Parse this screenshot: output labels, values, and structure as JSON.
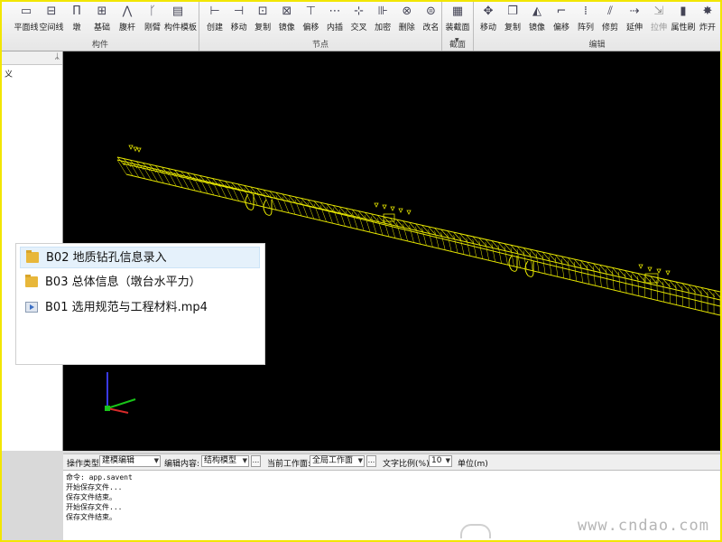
{
  "ribbon": {
    "left_labels": [
      "平面线",
      "空间线",
      "墩",
      "基础",
      "腹杆",
      "刚臂",
      "构件模板"
    ],
    "groups": [
      {
        "label": "构件",
        "tools": [
          {
            "label": "平面线",
            "icon": "plane-line-icon"
          },
          {
            "label": "空间线",
            "icon": "space-line-icon"
          },
          {
            "label": "墩",
            "icon": "pier-icon"
          },
          {
            "label": "基础",
            "icon": "foundation-icon"
          },
          {
            "label": "腹杆",
            "icon": "web-member-icon"
          },
          {
            "label": "刚臂",
            "icon": "rigid-arm-icon"
          },
          {
            "label": "构件模板",
            "icon": "member-template-icon"
          }
        ]
      },
      {
        "label": "节点",
        "tools": [
          {
            "label": "创建",
            "icon": "create-node-icon"
          },
          {
            "label": "移动",
            "icon": "move-node-icon"
          },
          {
            "label": "复制",
            "icon": "copy-node-icon"
          },
          {
            "label": "镜像",
            "icon": "mirror-node-icon"
          },
          {
            "label": "偏移",
            "icon": "offset-node-icon"
          },
          {
            "label": "内插",
            "icon": "interpolate-icon"
          },
          {
            "label": "交叉",
            "icon": "intersect-icon"
          },
          {
            "label": "加密",
            "icon": "densify-icon"
          },
          {
            "label": "删除",
            "icon": "delete-node-icon"
          },
          {
            "label": "改名",
            "icon": "rename-node-icon"
          }
        ]
      },
      {
        "label": "截面",
        "tools": [
          {
            "label": "装截面",
            "icon": "section-icon"
          }
        ]
      },
      {
        "label": "编辑",
        "tools": [
          {
            "label": "移动",
            "icon": "move-icon"
          },
          {
            "label": "复制",
            "icon": "copy-icon"
          },
          {
            "label": "镜像",
            "icon": "mirror-icon"
          },
          {
            "label": "偏移",
            "icon": "offset-icon"
          },
          {
            "label": "阵列",
            "icon": "array-icon"
          },
          {
            "label": "修剪",
            "icon": "trim-icon"
          },
          {
            "label": "延伸",
            "icon": "extend-icon"
          },
          {
            "label": "拉伸",
            "icon": "stretch-icon"
          },
          {
            "label": "属性刷",
            "icon": "property-brush-icon"
          },
          {
            "label": "炸开",
            "icon": "explode-icon"
          }
        ]
      }
    ]
  },
  "left_panel": {
    "pin": "ᛦ",
    "item": "义"
  },
  "popup": {
    "items": [
      {
        "name": "B02 地质钻孔信息录入",
        "type": "folder",
        "selected": true
      },
      {
        "name": "B03 总体信息（墩台水平力）",
        "type": "folder",
        "selected": false
      },
      {
        "name": "B01 选用规范与工程材料.mp4",
        "type": "video",
        "selected": false
      }
    ]
  },
  "statusbar": {
    "op_type_label": "操作类型:",
    "op_type_value": "建模编辑",
    "edit_content_label": "编辑内容:",
    "edit_content_value": "结构模型",
    "work_plane_label": "当前工作面:",
    "work_plane_value": "全局工作面",
    "text_ratio_label": "文字比例(%):",
    "text_ratio_value": "10",
    "unit_label": "单位(m)",
    "dots": "..."
  },
  "console": {
    "lines": [
      "命令: app.savent",
      "开始保存文件...",
      "保存文件结束。",
      "开始保存文件...",
      "保存文件结束。"
    ]
  },
  "watermark": "www.cndao.com",
  "colors": {
    "model": "#e8e800",
    "viewport": "#000000",
    "axis_x": "#19c419",
    "axis_y": "#3a3ae6",
    "axis_z": "#d82a2a"
  }
}
